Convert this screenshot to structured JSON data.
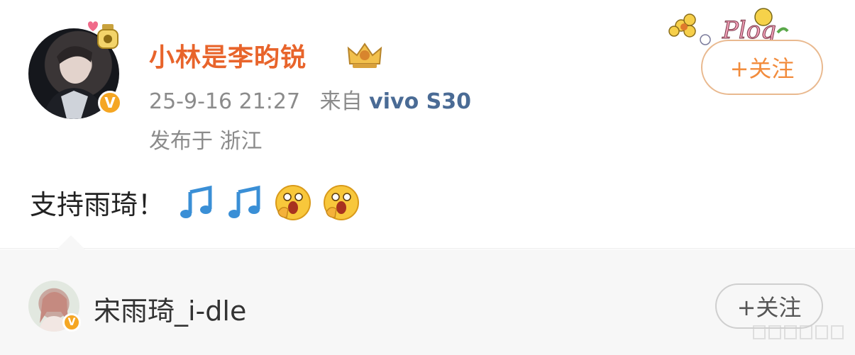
{
  "post": {
    "username": "小林是李昀锐",
    "datetime": "25-9-16 21:27",
    "source_prefix": "来自",
    "device": "vivo S30",
    "location": "发布于 浙江",
    "follow_label": "+关注",
    "content_text": "支持雨琦！",
    "emojis": [
      "music-note-icon",
      "music-note-icon",
      "surprised-face-icon",
      "surprised-face-icon"
    ],
    "verified_badge": "V",
    "sticker_text": "Plog"
  },
  "repost": {
    "username": "宋雨琦_i-dle",
    "follow_label": "+关注",
    "verified_badge": "V"
  },
  "colors": {
    "username": "#e8642b",
    "meta": "#8b8b8b",
    "device": "#4a6b95",
    "follow_border": "#e9b98f",
    "follow_text": "#f28c3d",
    "badge": "#f5a623"
  }
}
